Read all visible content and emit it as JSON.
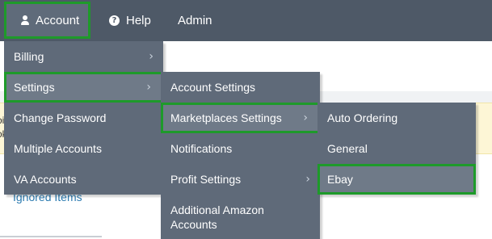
{
  "nav": {
    "account": "Account",
    "help": "Help",
    "admin": "Admin"
  },
  "background": {
    "left_fragment_1": "oi",
    "left_fragment_2": "ok",
    "link": "Ignored Items"
  },
  "menu_account": {
    "items": [
      {
        "label": "Billing"
      },
      {
        "label": "Settings"
      },
      {
        "label": "Change Password"
      },
      {
        "label": "Multiple Accounts"
      },
      {
        "label": "VA Accounts"
      }
    ]
  },
  "menu_settings": {
    "items": [
      {
        "label": "Account Settings"
      },
      {
        "label": "Marketplaces Settings"
      },
      {
        "label": "Notifications"
      },
      {
        "label": "Profit Settings"
      },
      {
        "label": "Additional Amazon Accounts"
      }
    ]
  },
  "menu_marketplaces": {
    "items": [
      {
        "label": "Auto Ordering"
      },
      {
        "label": "General"
      },
      {
        "label": "Ebay"
      }
    ]
  },
  "colors": {
    "navbar": "#4e5967",
    "menu": "#5f6a79",
    "highlight_border": "#1e9a2a",
    "link": "#2a7ab0"
  },
  "icons": {
    "account": "user-icon",
    "help": "help-icon",
    "submenu": "chevron-right-icon"
  }
}
